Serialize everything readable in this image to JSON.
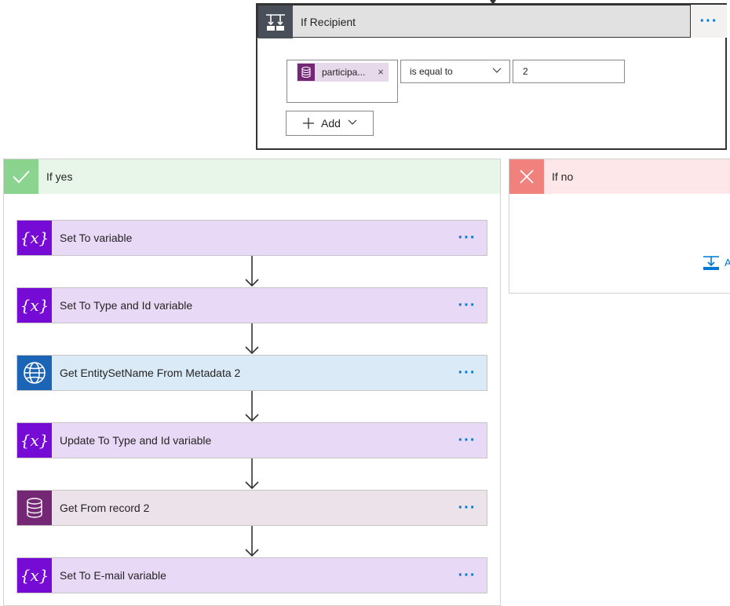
{
  "condition": {
    "title": "If Recipient",
    "left_token": "participa...",
    "remove_token": "×",
    "operator": "is equal to",
    "value": "2",
    "add_button": "Add"
  },
  "yes_branch": {
    "title": "If yes",
    "actions": [
      {
        "label": "Set To variable",
        "kind": "variable",
        "icon": "variable-icon"
      },
      {
        "label": "Set To Type and Id variable",
        "kind": "variable",
        "icon": "variable-icon"
      },
      {
        "label": "Get EntitySetName From Metadata 2",
        "kind": "http",
        "icon": "globe-icon"
      },
      {
        "label": "Update To Type and Id variable",
        "kind": "variable",
        "icon": "variable-icon"
      },
      {
        "label": "Get From record 2",
        "kind": "dataverse",
        "icon": "database-icon"
      },
      {
        "label": "Set To E-mail variable",
        "kind": "variable",
        "icon": "variable-icon"
      }
    ]
  },
  "no_branch": {
    "title": "If no",
    "add_action_partial": "A"
  },
  "more_symbol": "···",
  "colors": {
    "variable": "#770bd6",
    "variable_bg": "#e8d9f7",
    "http": "#1b64b6",
    "http_bg": "#daeaf7",
    "dataverse": "#742774",
    "dataverse_bg": "#ece2ea",
    "yes": "#8bd48f",
    "yes_bg": "#e7f6e9",
    "no": "#f1817d",
    "no_bg": "#fde7e9",
    "accent": "#0078d4"
  }
}
